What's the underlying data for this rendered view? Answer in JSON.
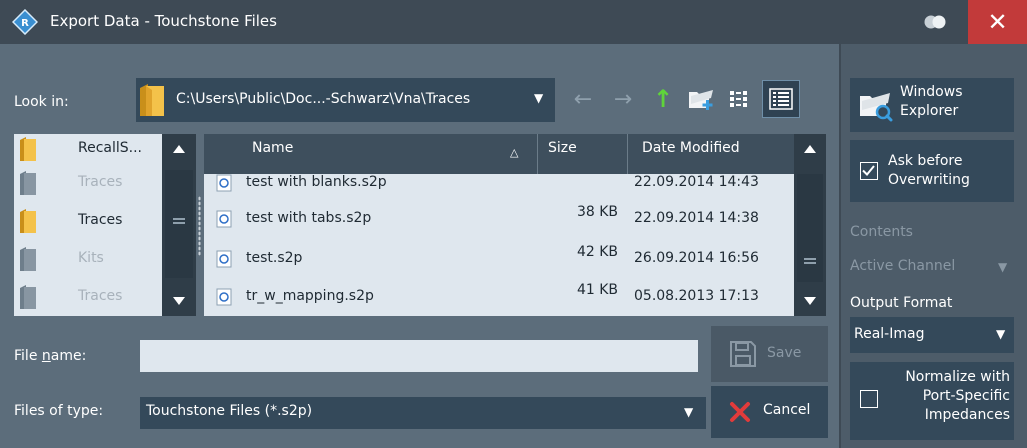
{
  "window": {
    "title": "Export Data - Touchstone Files",
    "close_label": "✕"
  },
  "toolbar": {
    "look_in_label": "Look in:",
    "look_in_path": "C:\\Users\\Public\\Doc...-Schwarz\\Vna\\Traces",
    "back_glyph": "←",
    "forward_glyph": "→",
    "up_glyph": "↑"
  },
  "sidebar": {
    "items": [
      {
        "label": "RecallS...",
        "state": "dark"
      },
      {
        "label": "Traces",
        "state": "dim"
      },
      {
        "label": "Traces",
        "state": "dark"
      },
      {
        "label": "Kits",
        "state": "dim"
      },
      {
        "label": "Traces",
        "state": "dim"
      }
    ]
  },
  "filelist": {
    "columns": {
      "name": "Name",
      "size": "Size",
      "date": "Date Modified"
    },
    "sort_indicator": "△",
    "rows": [
      {
        "name": "test with blanks.s2p",
        "size": "",
        "date": "22.09.2014 14:43"
      },
      {
        "name": "test with tabs.s2p",
        "size": "38 KB",
        "date": "22.09.2014 14:38"
      },
      {
        "name": "test.s2p",
        "size": "42 KB",
        "date": "26.09.2014 16:56"
      },
      {
        "name": "tr_w_mapping.s2p",
        "size": "41 KB",
        "date": "05.08.2013 17:13"
      }
    ]
  },
  "bottom": {
    "file_name_label_pre": "File ",
    "file_name_label_u": "n",
    "file_name_label_post": "ame:",
    "file_name_value": "",
    "files_of_type_label": "Files of type:",
    "files_of_type_value": "Touchstone Files (*.s2p)",
    "save_label": "Save",
    "cancel_label": "Cancel"
  },
  "right_panel": {
    "windows_explorer_label": "Windows Explorer",
    "ask_before_label": "Ask before Overwriting",
    "ask_before_checked": true,
    "contents_label": "Contents",
    "contents_value": "Active Channel",
    "output_format_label": "Output Format",
    "output_format_value": "Real-Imag",
    "normalize_label": "Normalize with Port-Specific Impedances",
    "normalize_checked": false
  },
  "colors": {
    "title_bar": "#3e4a55",
    "body": "#5c6d7b",
    "close": "#c23a3a",
    "button": "#34495a",
    "list_bg": "#dfe7ee",
    "up_arrow": "#5fd43a",
    "cancel_x": "#e23b3b"
  }
}
